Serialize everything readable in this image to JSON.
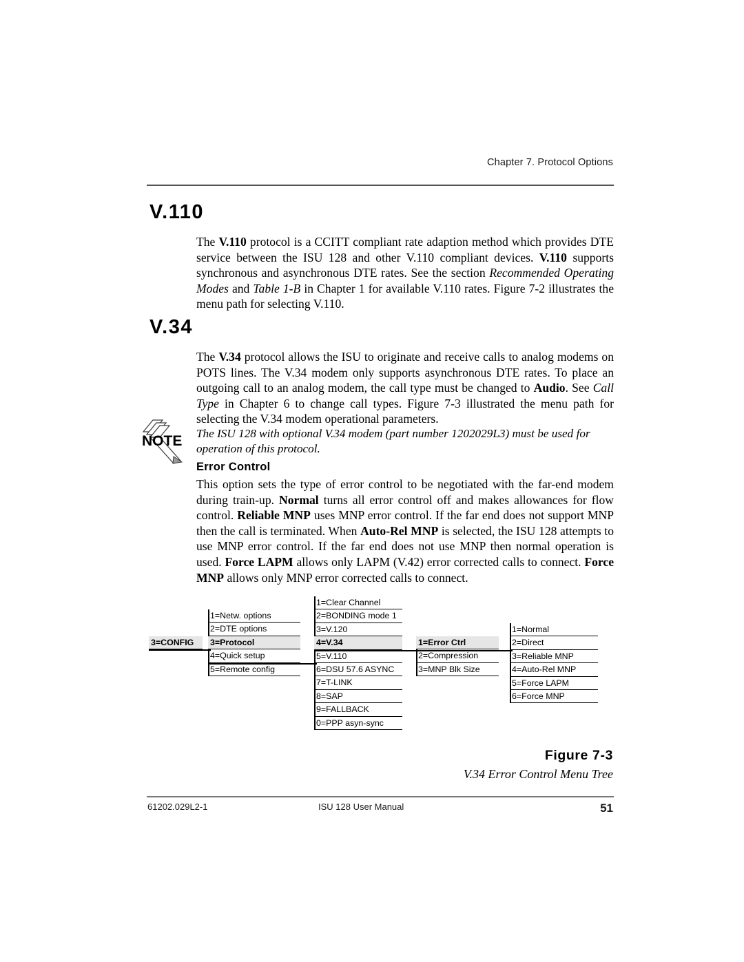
{
  "header": {
    "chapter": "Chapter 7. Protocol Options"
  },
  "sections": [
    {
      "heading": "V.110",
      "body_runs": [
        {
          "t": "The ",
          "s": "n"
        },
        {
          "t": "V.110",
          "s": "b"
        },
        {
          "t": " protocol is a CCITT compliant rate adaption method which provides DTE service between the ISU 128 and other V.110 compliant devices. ",
          "s": "n"
        },
        {
          "t": "V.110",
          "s": "b"
        },
        {
          "t": " supports synchronous and asynchronous DTE rates.  See the section ",
          "s": "n"
        },
        {
          "t": "Recommended Operating Modes",
          "s": "i"
        },
        {
          "t": " and ",
          "s": "n"
        },
        {
          "t": "Table 1-B",
          "s": "i"
        },
        {
          "t": " in Chapter 1 for available V.110 rates.  Figure 7-2 illustrates the menu path for selecting V.110.",
          "s": "n"
        }
      ]
    },
    {
      "heading": "V.34",
      "body_runs": [
        {
          "t": "The ",
          "s": "n"
        },
        {
          "t": "V.34",
          "s": "b"
        },
        {
          "t": " protocol allows the ISU to originate and receive calls to analog modems on POTS lines.  The V.34 modem only supports asynchronous DTE rates.  To place an outgoing call to an analog modem, the call type must be changed to ",
          "s": "n"
        },
        {
          "t": "Audio",
          "s": "b"
        },
        {
          "t": ".  See ",
          "s": "n"
        },
        {
          "t": "Call Type",
          "s": "i"
        },
        {
          "t": " in Chapter 6 to change call types.  Figure 7-3 illustrated the menu path for selecting the V.34 modem operational parameters.",
          "s": "n"
        }
      ]
    }
  ],
  "note": {
    "icon_label": "NOTE",
    "text": "The ISU 128 with optional V.34 modem (part number 1202029L3) must be used for operation of this protocol."
  },
  "error_control": {
    "heading": "Error Control",
    "body_runs": [
      {
        "t": "This option sets the type of error control to be negotiated with the far-end modem during train-up.  ",
        "s": "n"
      },
      {
        "t": "Normal",
        "s": "b"
      },
      {
        "t": " turns all error control off and makes allowances for flow control.   ",
        "s": "n"
      },
      {
        "t": "Reliable MNP",
        "s": "b"
      },
      {
        "t": " uses MNP error control.  If the far end does not support MNP then the call is terminated.  When ",
        "s": "n"
      },
      {
        "t": "Auto-Rel MNP",
        "s": "b"
      },
      {
        "t": " is selected, the ISU 128 attempts to use MNP error control.  If the far end does not use MNP then normal operation is used.  ",
        "s": "n"
      },
      {
        "t": "Force LAPM",
        "s": "b"
      },
      {
        "t": " allows only LAPM (V.42) error corrected calls to connect.  ",
        "s": "n"
      },
      {
        "t": "Force MNP",
        "s": "b"
      },
      {
        "t": " allows only MNP error corrected calls to connect.",
        "s": "n"
      }
    ]
  },
  "menu_tree": {
    "columns": [
      {
        "id": "config",
        "items": [
          {
            "label": "3=CONFIG",
            "highlight": true
          }
        ]
      },
      {
        "id": "config-submenu",
        "items": [
          {
            "label": "1=Netw. options",
            "highlight": false
          },
          {
            "label": "2=DTE options",
            "highlight": false
          },
          {
            "label": "3=Protocol",
            "highlight": true
          },
          {
            "label": "4=Quick setup",
            "highlight": false
          },
          {
            "label": "5=Remote config",
            "highlight": false
          }
        ]
      },
      {
        "id": "protocol-submenu",
        "items": [
          {
            "label": "1=Clear Channel",
            "highlight": false
          },
          {
            "label": "2=BONDING mode 1",
            "highlight": false
          },
          {
            "label": "3=V.120",
            "highlight": false
          },
          {
            "label": "4=V.34",
            "highlight": true
          },
          {
            "label": "5=V.110",
            "highlight": false
          },
          {
            "label": "6=DSU 57.6 ASYNC",
            "highlight": false
          },
          {
            "label": "7=T-LINK",
            "highlight": false
          },
          {
            "label": "8=SAP",
            "highlight": false
          },
          {
            "label": "9=FALLBACK",
            "highlight": false
          },
          {
            "label": "0=PPP asyn-sync",
            "highlight": false
          }
        ]
      },
      {
        "id": "v34-submenu",
        "items": [
          {
            "label": "1=Error Ctrl",
            "highlight": true
          },
          {
            "label": "2=Compression",
            "highlight": false
          },
          {
            "label": "3=MNP Blk Size",
            "highlight": false
          }
        ]
      },
      {
        "id": "errorctrl-submenu",
        "items": [
          {
            "label": "1=Normal",
            "highlight": false
          },
          {
            "label": "2=Direct",
            "highlight": false
          },
          {
            "label": "3=Reliable MNP",
            "highlight": false
          },
          {
            "label": "4=Auto-Rel MNP",
            "highlight": false
          },
          {
            "label": "5=Force LAPM",
            "highlight": false
          },
          {
            "label": "6=Force MNP",
            "highlight": false
          }
        ]
      }
    ]
  },
  "figure": {
    "number": "Figure 7-3",
    "caption": "V.34 Error Control Menu Tree"
  },
  "footer": {
    "left": "61202.029L2-1",
    "center": "ISU 128 User Manual",
    "page": "51"
  },
  "colors": {
    "highlight": "#e6e6e6",
    "rule": "#555555",
    "text": "#000000"
  }
}
